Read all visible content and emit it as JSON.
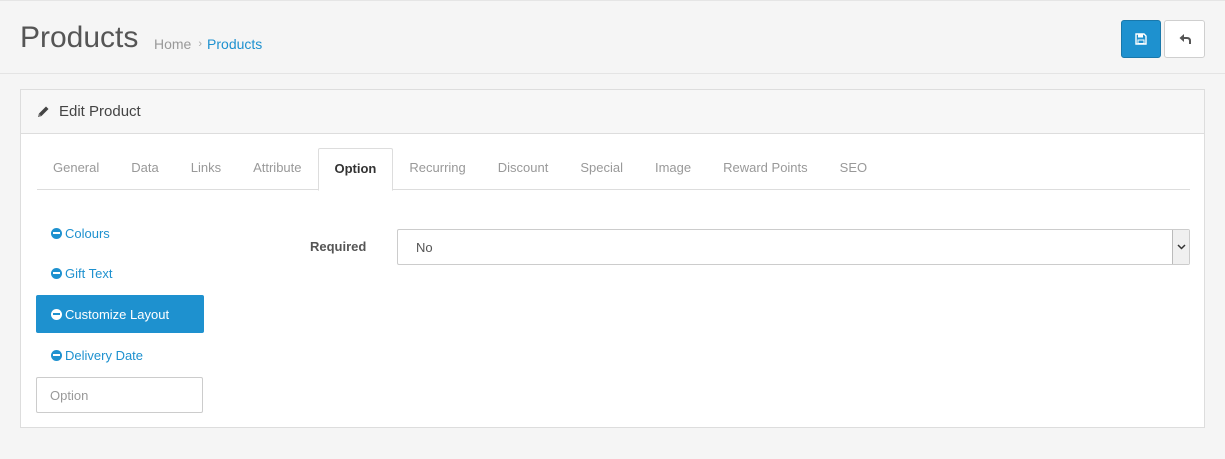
{
  "header": {
    "title": "Products",
    "breadcrumb": {
      "home": "Home",
      "separator": "›",
      "current": "Products"
    }
  },
  "buttons": {
    "save_icon": "save-icon",
    "back_icon": "reply-icon"
  },
  "panel": {
    "title": "Edit Product",
    "icon": "pencil-icon"
  },
  "tabs": [
    {
      "label": "General"
    },
    {
      "label": "Data"
    },
    {
      "label": "Links"
    },
    {
      "label": "Attribute"
    },
    {
      "label": "Option",
      "active": true
    },
    {
      "label": "Recurring"
    },
    {
      "label": "Discount"
    },
    {
      "label": "Special"
    },
    {
      "label": "Image"
    },
    {
      "label": "Reward Points"
    },
    {
      "label": "SEO"
    }
  ],
  "options": {
    "items": [
      {
        "label": "Colours"
      },
      {
        "label": "Gift Text"
      },
      {
        "label": "Customize Layout",
        "active": true
      },
      {
        "label": "Delivery Date"
      }
    ],
    "input_placeholder": "Option"
  },
  "required": {
    "label": "Required",
    "value": "No"
  },
  "colors": {
    "primary": "#1e91cf",
    "background": "#f5f5f5"
  }
}
